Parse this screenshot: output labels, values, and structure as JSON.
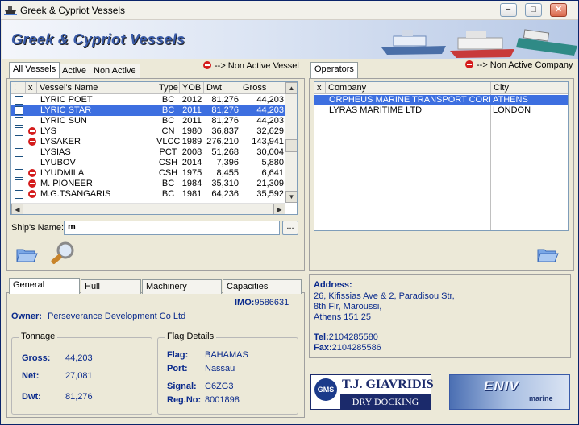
{
  "window": {
    "title": "Greek & Cypriot Vessels",
    "app_title": "Greek & Cypriot Vessels",
    "minimize": "−",
    "maximize": "□",
    "close": "✕"
  },
  "vessel_tabs": [
    "All Vessels",
    "Active",
    "Non Active"
  ],
  "non_active_vessel_note": "--> Non Active Vessel",
  "vessel_grid": {
    "columns": [
      "!",
      "x",
      "Vessel's Name",
      "Type",
      "YOB",
      "Dwt",
      "Gross"
    ],
    "rows": [
      {
        "inactive": false,
        "name": "LYRIC POET",
        "type": "BC",
        "yob": "2012",
        "dwt": "81,276",
        "gross": "44,203",
        "selected": false
      },
      {
        "inactive": false,
        "name": "LYRIC STAR",
        "type": "BC",
        "yob": "2011",
        "dwt": "81,276",
        "gross": "44,203",
        "selected": true
      },
      {
        "inactive": false,
        "name": "LYRIC SUN",
        "type": "BC",
        "yob": "2011",
        "dwt": "81,276",
        "gross": "44,203",
        "selected": false
      },
      {
        "inactive": true,
        "name": "LYS",
        "type": "CN",
        "yob": "1980",
        "dwt": "36,837",
        "gross": "32,629",
        "selected": false
      },
      {
        "inactive": true,
        "name": "LYSAKER",
        "type": "VLCC",
        "yob": "1989",
        "dwt": "276,210",
        "gross": "143,941",
        "selected": false
      },
      {
        "inactive": false,
        "name": "LYSIAS",
        "type": "PCT",
        "yob": "2008",
        "dwt": "51,268",
        "gross": "30,004",
        "selected": false
      },
      {
        "inactive": false,
        "name": "LYUBOV",
        "type": "CSH",
        "yob": "2014",
        "dwt": "7,396",
        "gross": "5,880",
        "selected": false
      },
      {
        "inactive": true,
        "name": "LYUDMILA",
        "type": "CSH",
        "yob": "1975",
        "dwt": "8,455",
        "gross": "6,641",
        "selected": false
      },
      {
        "inactive": true,
        "name": "M. PIONEER",
        "type": "BC",
        "yob": "1984",
        "dwt": "35,310",
        "gross": "21,309",
        "selected": false
      },
      {
        "inactive": true,
        "name": "M.G.TSANGARIS",
        "type": "BC",
        "yob": "1981",
        "dwt": "64,236",
        "gross": "35,592",
        "selected": false
      }
    ]
  },
  "ships_name": {
    "label": "Ship's Name:",
    "value": "m",
    "browse": "..."
  },
  "operators_tab": "Operators",
  "non_active_company_note": "--> Non Active Company",
  "operators_grid": {
    "columns": [
      "x",
      "Company",
      "City"
    ],
    "rows": [
      {
        "company": "ORPHEUS MARINE TRANSPORT CORP",
        "city": "ATHENS",
        "selected": true
      },
      {
        "company": "LYRAS MARITIME LTD",
        "city": "LONDON",
        "selected": false
      }
    ]
  },
  "detail_tabs": [
    "General",
    "Hull",
    "Machinery",
    "Capacities"
  ],
  "general": {
    "imo_label": "IMO:",
    "imo": "9586631",
    "owner_label": "Owner:",
    "owner": "Perseverance Development Co Ltd",
    "tonnage_title": "Tonnage",
    "gross_label": "Gross:",
    "gross": "44,203",
    "net_label": "Net:",
    "net": "27,081",
    "dwt_label": "Dwt:",
    "dwt": "81,276",
    "flag_title": "Flag Details",
    "flag_label": "Flag:",
    "flag": "BAHAMAS",
    "port_label": "Port:",
    "port": "Nassau",
    "signal_label": "Signal:",
    "signal": "C6ZG3",
    "regno_label": "Reg.No:",
    "regno": "8001898"
  },
  "address": {
    "label": "Address:",
    "lines": [
      "26, Kifissias Ave & 2, Paradisou Str,",
      "8th Flr, Maroussi,",
      "Athens 151 25"
    ],
    "tel_label": "Tel:",
    "tel": "2104285580",
    "fax_label": "Fax:",
    "fax": "2104285586"
  },
  "ads": {
    "gavridis_badge": "GMS",
    "gavridis_name": "T.J. GIAVRIDIS",
    "gavridis_sub": "DRY DOCKING",
    "eniv_brand": "ENIV",
    "eniv_sub": "marine"
  },
  "colors": {
    "selection": "#3d6fe0",
    "accent_blue": "#0a2a8c",
    "inactive_red": "#d41c1c"
  }
}
